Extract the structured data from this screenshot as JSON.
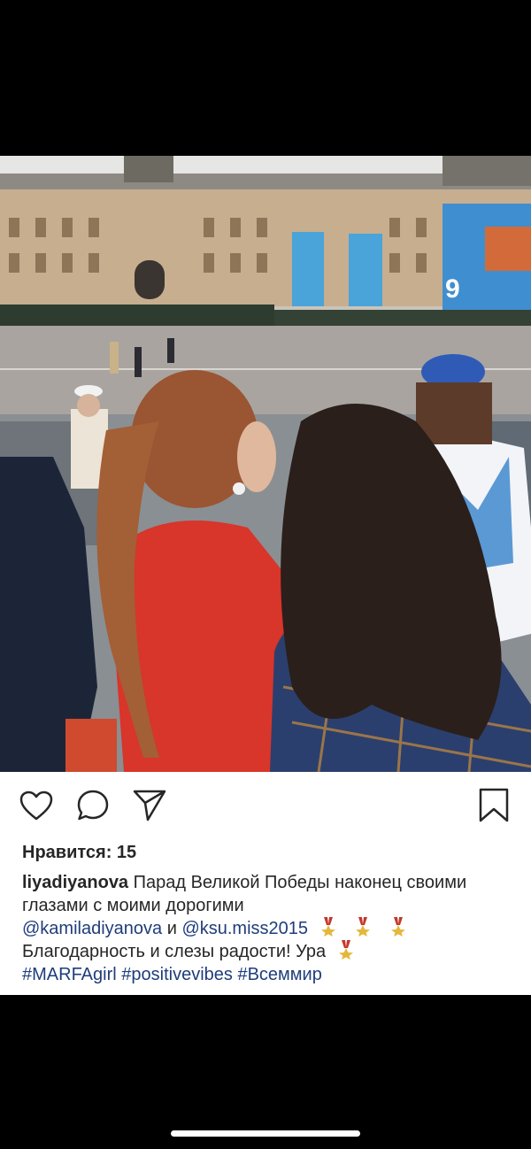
{
  "post": {
    "photo": {
      "description_icon": "photo-parade-image"
    },
    "actions": {
      "like_icon": "heart-icon",
      "comment_icon": "comment-icon",
      "share_icon": "send-icon",
      "save_icon": "bookmark-icon"
    },
    "likes_text": "Нравится: 15",
    "caption": {
      "username": "liyadiyanova",
      "text_1": " Парад Великой Победы наконец своими глазами с моими дорогими ",
      "mention_1": "@kamiladiyanova",
      "conj": " и ",
      "mention_2": "@ksu.miss2015",
      "text_2": "Благодарность и слезы радости! Ура",
      "hashtag_1": "#MARFAgirl",
      "hashtag_2": "#positivevibes",
      "hashtag_3": "#Всеммир",
      "medal_icon": "medal-icon"
    },
    "banner_text": "9"
  },
  "colors": {
    "link": "#1f3d7a",
    "text": "#262626",
    "coat_red": "#d8352b"
  }
}
